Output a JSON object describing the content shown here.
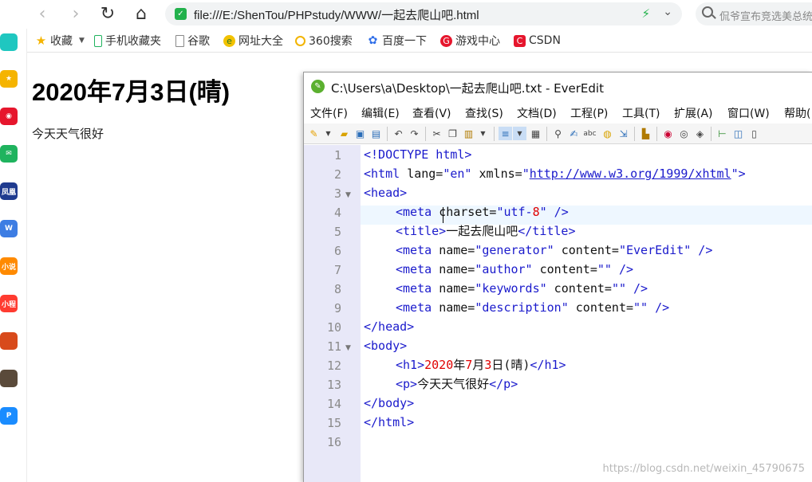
{
  "browser": {
    "back_glyph": "‹",
    "forward_glyph": "›",
    "reload_glyph": "↻",
    "home_glyph": "⌂",
    "address": {
      "url": "file:///E:/ShenTou/PHPstudy/WWW/一起去爬山吧.html"
    },
    "search": {
      "placeholder": "侃爷宣布竞选美总统"
    },
    "bookmarks": [
      {
        "label": "收藏",
        "icon": "star-icon"
      },
      {
        "label": "手机收藏夹",
        "icon": "phone-icon"
      },
      {
        "label": "谷歌",
        "icon": "page-icon"
      },
      {
        "label": "网址大全",
        "icon": "globe-icon"
      },
      {
        "label": "360搜索",
        "icon": "search-icon"
      },
      {
        "label": "百度一下",
        "icon": "paw-icon"
      },
      {
        "label": "游戏中心",
        "icon": "game-icon"
      },
      {
        "label": "CSDN",
        "icon": "csdn-icon"
      }
    ],
    "sidebar_apps": [
      {
        "name": "plus-app-icon",
        "color": "#1fc7c0"
      },
      {
        "name": "favorites-app-icon",
        "color": "#f5b400"
      },
      {
        "name": "weibo-app-icon",
        "color": "#e6162d"
      },
      {
        "name": "mail-app-icon",
        "color": "#1fb35e"
      },
      {
        "name": "news-app-icon",
        "color": "#1f3b8f",
        "text": "凤凰"
      },
      {
        "name": "doc-app-icon",
        "color": "#3d7de3",
        "text": "W"
      },
      {
        "name": "novel-app-icon",
        "color": "#ff8a00",
        "text": "小说"
      },
      {
        "name": "program-app-icon",
        "color": "#ff3b30",
        "text": "小程"
      },
      {
        "name": "game-app-icon",
        "color": "#d84a1b"
      },
      {
        "name": "temple-app-icon",
        "color": "#5a4a3a"
      },
      {
        "name": "p-app-icon",
        "color": "#1a8cff",
        "text": "P"
      }
    ]
  },
  "page": {
    "h1": "2020年7月3日(晴)",
    "p": "今天天气很好"
  },
  "editor": {
    "title": "C:\\Users\\a\\Desktop\\一起去爬山吧.txt - EverEdit",
    "menu": [
      "文件(F)",
      "编辑(E)",
      "查看(V)",
      "查找(S)",
      "文档(D)",
      "工程(P)",
      "工具(T)",
      "扩展(A)",
      "窗口(W)",
      "帮助("
    ],
    "line_numbers": [
      "1",
      "2",
      "3",
      "4",
      "5",
      "6",
      "7",
      "8",
      "9",
      "10",
      "11",
      "12",
      "13",
      "14",
      "15",
      "16"
    ],
    "code": {
      "l1": "<!DOCTYPE html>",
      "l2a": "<html ",
      "l2b": "lang=",
      "l2c": "\"en\"",
      "l2d": " xmlns=",
      "l2e": "\"",
      "l2f": "http://www.w3.org/1999/xhtml",
      "l2g": "\">",
      "l3": "<head>",
      "l4a": "<meta ",
      "l4b": "charset=",
      "l4c": "\"utf-",
      "l4d": "8",
      "l4e": "\" />",
      "l5a": "<title>",
      "l5b": "一起去爬山吧",
      "l5c": "</title>",
      "l6a": "<meta ",
      "l6b": "name=",
      "l6c": "\"generator\"",
      "l6d": " content=",
      "l6e": "\"EverEdit\"",
      "l6f": " />",
      "l7a": "<meta ",
      "l7b": "name=",
      "l7c": "\"author\"",
      "l7d": " content=",
      "l7e": "\"\"",
      "l7f": " />",
      "l8a": "<meta ",
      "l8b": "name=",
      "l8c": "\"keywords\"",
      "l8d": " content=",
      "l8e": "\"\"",
      "l8f": " />",
      "l9a": "<meta ",
      "l9b": "name=",
      "l9c": "\"description\"",
      "l9d": " content=",
      "l9e": "\"\"",
      "l9f": " />",
      "l10": "</head>",
      "l11": "<body>",
      "l12a": "<h1>",
      "l12b": "2020",
      "l12c": "年",
      "l12d": "7",
      "l12e": "月",
      "l12f": "3",
      "l12g": "日(晴)",
      "l12h": "</h1>",
      "l13a": "<p>",
      "l13b": "今天天气很好",
      "l13c": "</p>",
      "l14": "</body>",
      "l15": "</html>"
    },
    "watermark": "https://blog.csdn.net/weixin_45790675"
  }
}
